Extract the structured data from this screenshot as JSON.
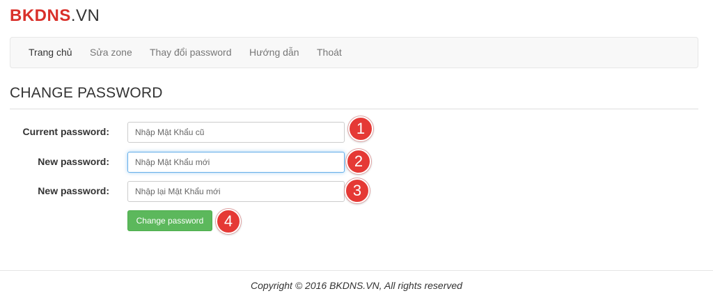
{
  "logo": {
    "brand": "BKDNS",
    "tld": ".VN"
  },
  "nav": {
    "items": [
      {
        "label": "Trang chủ",
        "active": true
      },
      {
        "label": "Sửa zone",
        "active": false
      },
      {
        "label": "Thay đổi password",
        "active": false
      },
      {
        "label": "Hướng dẫn",
        "active": false
      },
      {
        "label": "Thoát",
        "active": false
      }
    ]
  },
  "page": {
    "title": "CHANGE PASSWORD"
  },
  "form": {
    "current_password": {
      "label": "Current password:",
      "placeholder": "Nhập Mật Khẩu cũ",
      "value": ""
    },
    "new_password": {
      "label": "New password:",
      "placeholder": "Nhập Mật Khẩu mới",
      "value": ""
    },
    "confirm_password": {
      "label": "New password:",
      "placeholder": "Nhập lại Mật Khẩu mới",
      "value": ""
    },
    "submit_label": "Change password"
  },
  "annotations": [
    "1",
    "2",
    "3",
    "4"
  ],
  "colors": {
    "brand": "#d9302a",
    "submit_button": "#5cb85c",
    "annotation_badge": "#e53935",
    "focus_border": "#66afe9"
  },
  "footer": {
    "text": "Copyright © 2016 BKDNS.VN, All rights reserved"
  }
}
